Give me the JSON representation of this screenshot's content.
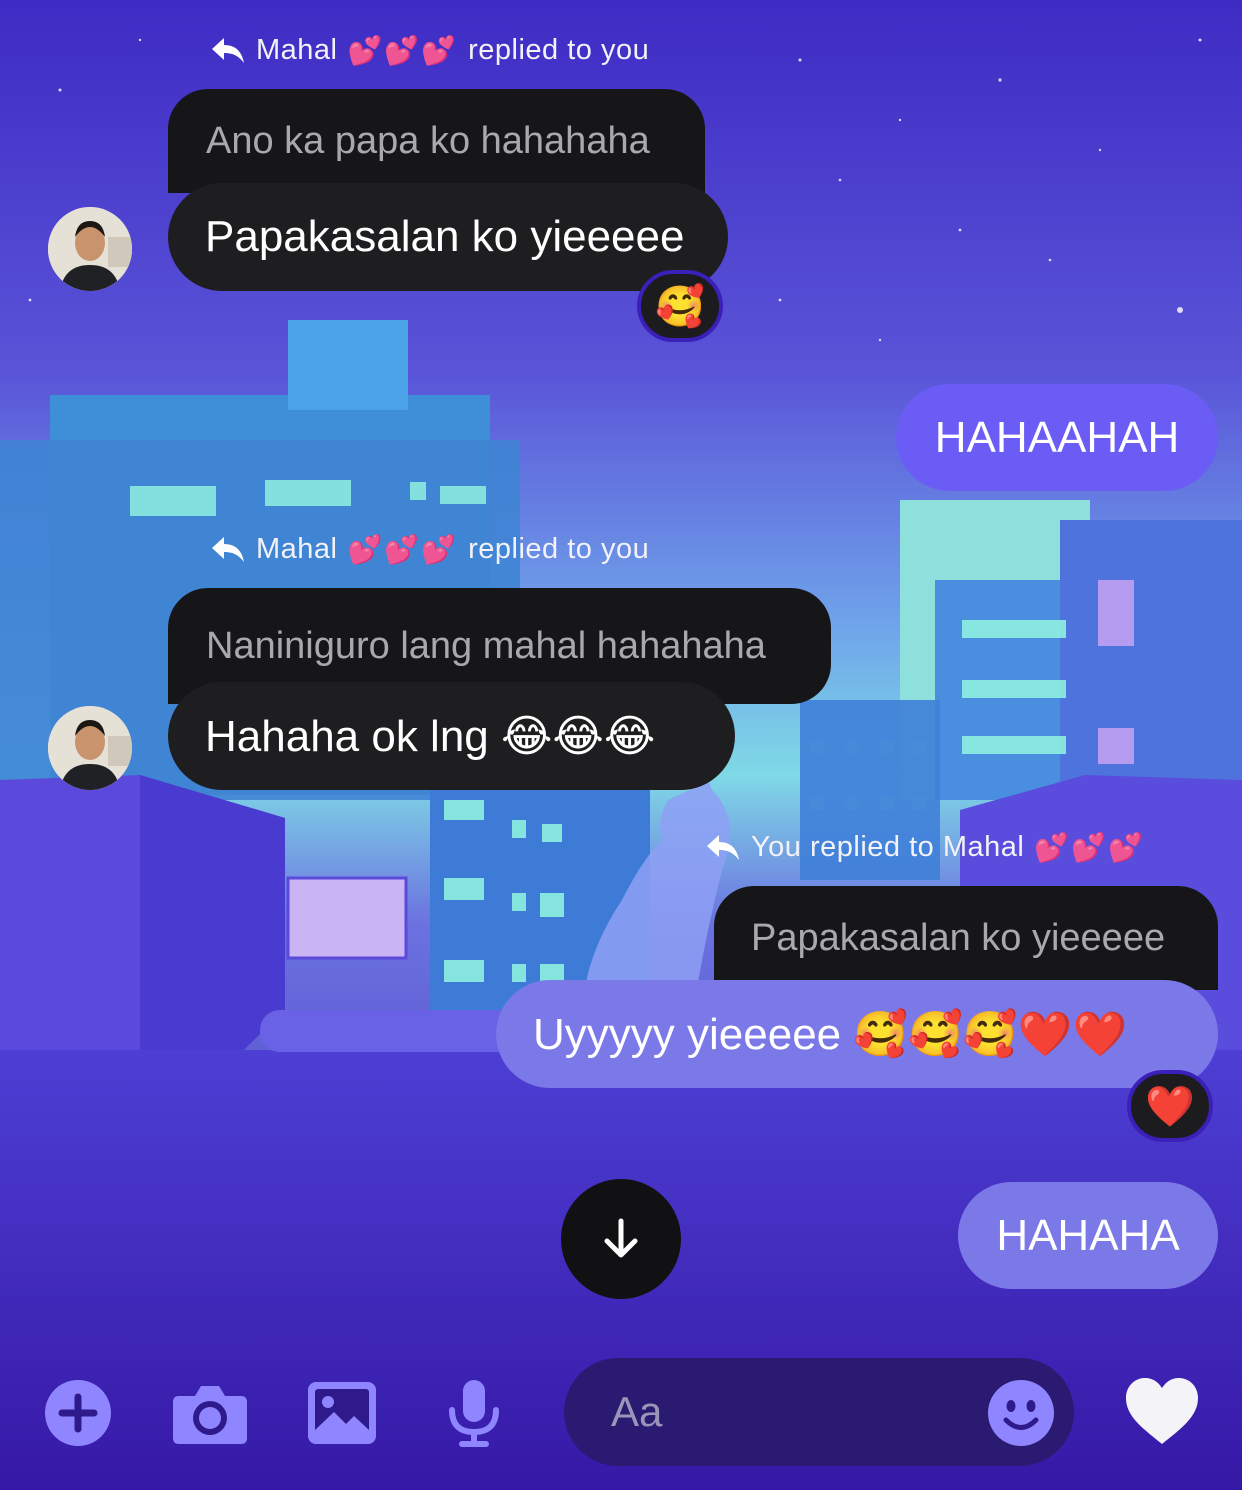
{
  "colors": {
    "outgoing_bubble": "#6b5cf6",
    "outgoing_bubble_light": "#7b78e8",
    "incoming_bubble": "#1e1e20",
    "quoted_bubble": "#161618",
    "accent": "#8f86ff"
  },
  "messages": {
    "reply1": {
      "header_name": "Mahal",
      "header_hearts": "💕💕💕",
      "header_suffix": "replied to you",
      "quoted_text": "Ano ka papa ko hahahaha",
      "text": "Papakasalan ko yieeeee",
      "reaction": "🥰"
    },
    "out1": {
      "text": "HAHAAHAH"
    },
    "reply2": {
      "header_name": "Mahal",
      "header_hearts": "💕💕💕",
      "header_suffix": "replied to you",
      "quoted_text": "Naniniguro lang mahal hahahaha",
      "text": "Hahaha ok lng 😂😂😂"
    },
    "out_reply": {
      "header_prefix": "You replied to Mahal",
      "header_hearts": "💕💕💕",
      "quoted_text": "Papakasalan ko yieeeee",
      "text": "Uyyyyy yieeeee 🥰🥰🥰❤️❤️",
      "reaction": "❤️"
    },
    "out2": {
      "text": "HAHAHA"
    }
  },
  "composer": {
    "add_icon": "plus-circle-icon",
    "camera_icon": "camera-icon",
    "gallery_icon": "photo-icon",
    "mic_icon": "microphone-icon",
    "placeholder": "Aa",
    "emoji_icon": "smiley-icon",
    "like_icon": "heart-icon"
  },
  "scroll_icon": "arrow-down-icon"
}
